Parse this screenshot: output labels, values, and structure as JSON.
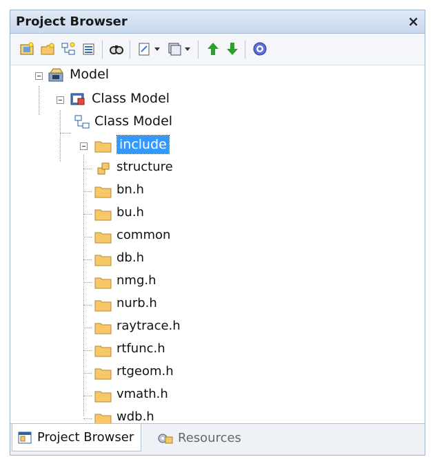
{
  "window": {
    "title": "Project Browser",
    "close_glyph": "×"
  },
  "toolbar": {
    "buttons": [
      "new-model-icon",
      "new-package-icon",
      "new-diagram-icon",
      "new-element-icon",
      "find-icon",
      "document-icon",
      "dropdown-arrow-icon",
      "view-icon",
      "dropdown-arrow-icon",
      "move-up-icon",
      "move-down-icon",
      "help-icon"
    ]
  },
  "tree": {
    "root": {
      "label": "Model",
      "icon": "model-root-icon",
      "expanded": true
    },
    "class_model_package": {
      "label": "Class Model",
      "icon": "package-view-icon",
      "expanded": true
    },
    "class_model_diagram": {
      "label": "Class Model",
      "icon": "class-diagram-icon"
    },
    "include": {
      "label": "include",
      "icon": "folder-icon",
      "expanded": true,
      "selected": true
    },
    "children": [
      {
        "label": "structure",
        "icon": "structure-element-icon"
      },
      {
        "label": "bn.h",
        "icon": "folder-icon"
      },
      {
        "label": "bu.h",
        "icon": "folder-icon"
      },
      {
        "label": "common",
        "icon": "folder-icon"
      },
      {
        "label": "db.h",
        "icon": "folder-icon"
      },
      {
        "label": "nmg.h",
        "icon": "folder-icon"
      },
      {
        "label": "nurb.h",
        "icon": "folder-icon"
      },
      {
        "label": "raytrace.h",
        "icon": "folder-icon"
      },
      {
        "label": "rtfunc.h",
        "icon": "folder-icon"
      },
      {
        "label": "rtgeom.h",
        "icon": "folder-icon"
      },
      {
        "label": "vmath.h",
        "icon": "folder-icon"
      },
      {
        "label": "wdb.h",
        "icon": "folder-icon"
      }
    ]
  },
  "tabs": [
    {
      "label": "Project Browser",
      "icon": "project-browser-icon",
      "active": true
    },
    {
      "label": "Resources",
      "icon": "resources-icon",
      "active": false
    }
  ],
  "colors": {
    "selection": "#3399ff",
    "folder": "#f6c86a",
    "title_bg": "#c9d9ee"
  }
}
